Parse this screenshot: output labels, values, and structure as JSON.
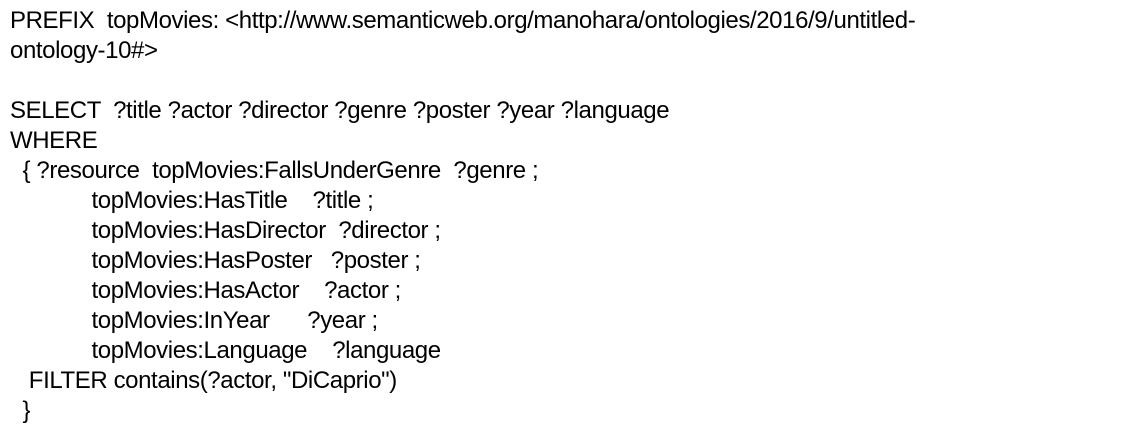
{
  "query": {
    "prefix_line_1": "PREFIX  topMovies: <http://www.semanticweb.org/manohara/ontologies/2016/9/untitled-",
    "prefix_line_2": "ontology-10#>",
    "select_line": "SELECT  ?title ?actor ?director ?genre ?poster ?year ?language",
    "where_line": "WHERE",
    "triples": [
      "  { ?resource  topMovies:FallsUnderGenre  ?genre ;",
      "             topMovies:HasTitle    ?title ;",
      "             topMovies:HasDirector  ?director ;",
      "             topMovies:HasPoster   ?poster ;",
      "             topMovies:HasActor    ?actor ;",
      "             topMovies:InYear      ?year ;",
      "             topMovies:Language    ?language"
    ],
    "filter_line": "   FILTER contains(?actor, \"DiCaprio\")",
    "close_line": "  }"
  }
}
